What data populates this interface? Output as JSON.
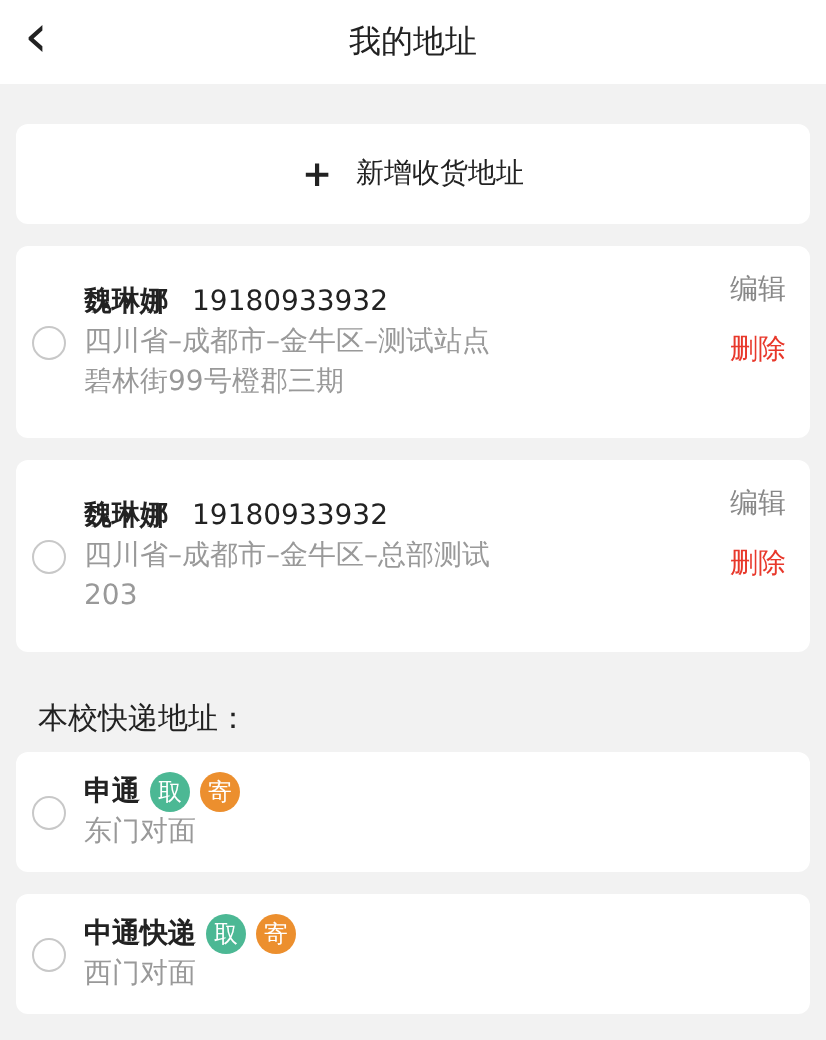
{
  "header": {
    "back_icon": "‹",
    "title": "我的地址"
  },
  "add_button": {
    "icon": "+",
    "label": "新增收货地址"
  },
  "addresses": [
    {
      "name": "魏琳娜",
      "phone": "19180933932",
      "address_lines": [
        "四川省–成都市–金牛区–测试站点",
        "碧林街99号橙郡三期"
      ],
      "selected": false,
      "edit": "编辑",
      "delete": "删除"
    },
    {
      "name": "魏琳娜",
      "phone": "19180933932",
      "address_lines": [
        "四川省–成都市–金牛区–总部测试",
        "203"
      ],
      "selected": false,
      "edit": "编辑",
      "delete": "删除"
    }
  ],
  "section_title": "本校快递地址：",
  "couriers": [
    {
      "name": "申通",
      "location": "东门对面",
      "selected": false,
      "badges": [
        {
          "label": "取",
          "color": "#4cb894"
        },
        {
          "label": "寄",
          "color": "#ec8f2e"
        }
      ]
    },
    {
      "name": "中通快递",
      "location": "西门对面",
      "selected": false,
      "badges": [
        {
          "label": "取",
          "color": "#4cb894"
        },
        {
          "label": "寄",
          "color": "#ec8f2e"
        }
      ]
    }
  ]
}
